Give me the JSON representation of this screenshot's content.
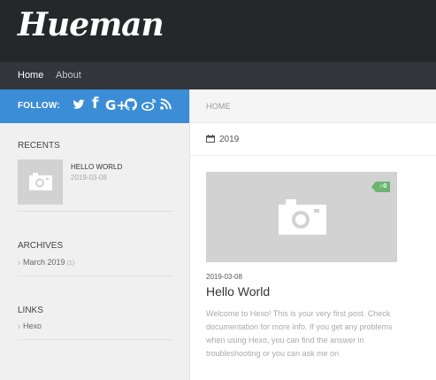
{
  "site": {
    "logo_text": "Hueman"
  },
  "nav": {
    "items": [
      {
        "label": "Home"
      },
      {
        "label": "About"
      }
    ]
  },
  "sidebar": {
    "follow_label": "FOLLOW:",
    "social_icons": [
      "twitter-icon",
      "facebook-icon",
      "google-plus-icon",
      "github-icon",
      "weibo-icon",
      "rss-icon"
    ],
    "recents": {
      "title": "RECENTS",
      "items": [
        {
          "title": "HELLO WORLD",
          "date": "2019-03-08"
        }
      ]
    },
    "archives": {
      "title": "ARCHIVES",
      "items": [
        {
          "label": "March 2019",
          "count": "(1)"
        }
      ]
    },
    "links": {
      "title": "LINKS",
      "items": [
        {
          "label": "Hexo"
        }
      ]
    }
  },
  "main": {
    "breadcrumb": "HOME",
    "archive_year": "2019",
    "post": {
      "comment_count": "0",
      "date": "2019-03-08",
      "title": "Hello World",
      "excerpt": "Welcome to Hexo! This is your very first post. Check documentation for more info. If you get any problems when using Hexo, you can find the answer in troubleshooting or you can ask me on"
    }
  },
  "colors": {
    "header_bg": "#26272b",
    "nav_bg": "#33363b",
    "follow_bg": "#3b8dd5",
    "comment_badge": "#6bb56f",
    "sidebar_bg": "#f0f0f0",
    "placeholder_bg": "#d2d2d2"
  }
}
